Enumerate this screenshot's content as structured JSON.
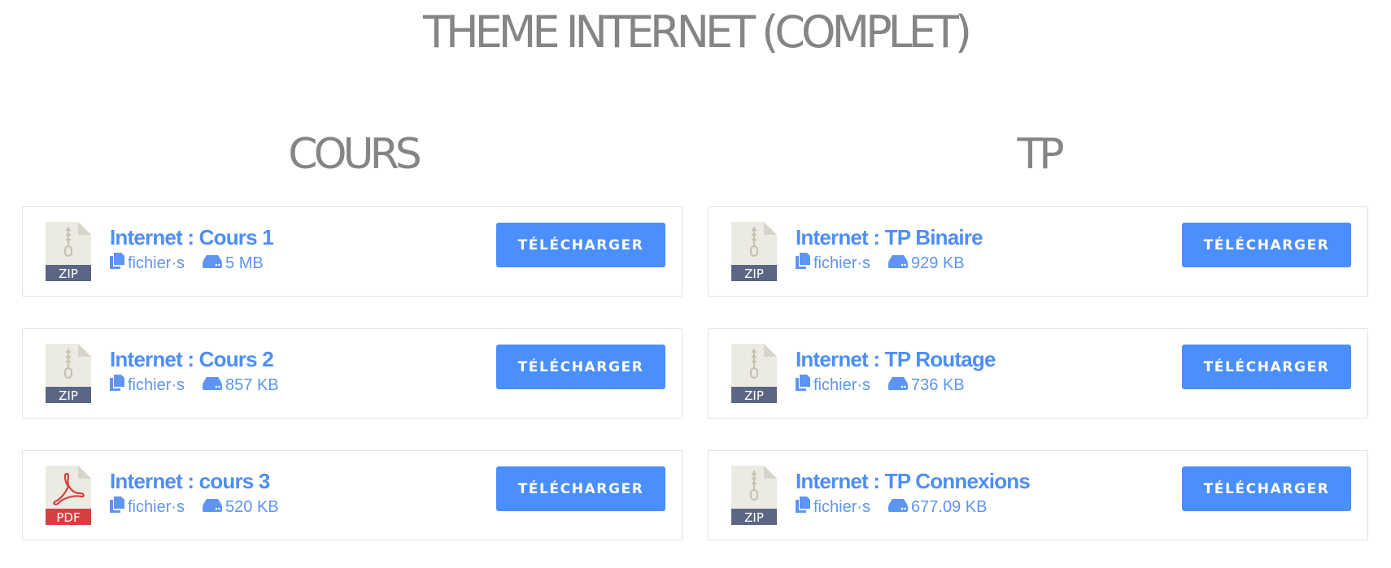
{
  "page_title": "THEME INTERNET (COMPLET)",
  "colors": {
    "accent": "#4a8ffc",
    "title_link": "#4e8ef7",
    "heading": "#858585",
    "zip_band": "#5a6684",
    "pdf_band": "#d54040"
  },
  "columns": [
    {
      "title": "COURS",
      "items": [
        {
          "title": "Internet : Cours 1",
          "type": "ZIP",
          "files_label": "fichier·s",
          "size": "5 MB",
          "button": "TÉLÉCHARGER"
        },
        {
          "title": "Internet : Cours 2",
          "type": "ZIP",
          "files_label": "fichier·s",
          "size": "857 KB",
          "button": "TÉLÉCHARGER"
        },
        {
          "title": "Internet : cours 3",
          "type": "PDF",
          "files_label": "fichier·s",
          "size": "520 KB",
          "button": "TÉLÉCHARGER"
        }
      ]
    },
    {
      "title": "TP",
      "items": [
        {
          "title": "Internet : TP Binaire",
          "type": "ZIP",
          "files_label": "fichier·s",
          "size": "929 KB",
          "button": "TÉLÉCHARGER"
        },
        {
          "title": "Internet : TP Routage",
          "type": "ZIP",
          "files_label": "fichier·s",
          "size": "736 KB",
          "button": "TÉLÉCHARGER"
        },
        {
          "title": "Internet : TP Connexions",
          "type": "ZIP",
          "files_label": "fichier·s",
          "size": "677.09 KB",
          "button": "TÉLÉCHARGER"
        }
      ]
    }
  ]
}
